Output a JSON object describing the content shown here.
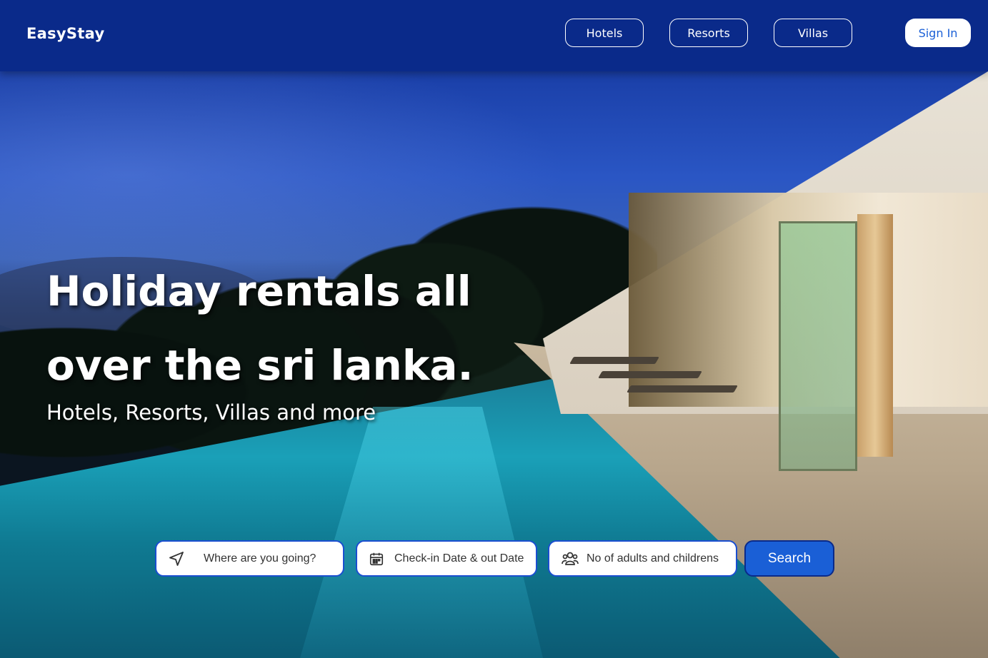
{
  "brand": {
    "name": "EasyStay"
  },
  "nav": {
    "items": [
      {
        "label": "Hotels"
      },
      {
        "label": "Resorts"
      },
      {
        "label": "Villas"
      }
    ],
    "signin_label": "Sign In"
  },
  "hero": {
    "headline_line1": "Holiday rentals all",
    "headline_line2": "over the sri lanka.",
    "subheadline": "Hotels, Resorts, Villas and more",
    "background_icon": "night-villa-infinity-pool-photo"
  },
  "search": {
    "destination": {
      "placeholder": "Where are you going?",
      "icon": "navigation-arrow-icon"
    },
    "dates": {
      "placeholder": "Check-in Date & out Date",
      "icon": "calendar-icon"
    },
    "guests": {
      "placeholder": "No of adults and childrens",
      "icon": "people-icon"
    },
    "button_label": "Search"
  },
  "colors": {
    "nav_bg": "#0a2a8a",
    "accent": "#1a5fd6",
    "text_on_dark": "#ffffff"
  }
}
